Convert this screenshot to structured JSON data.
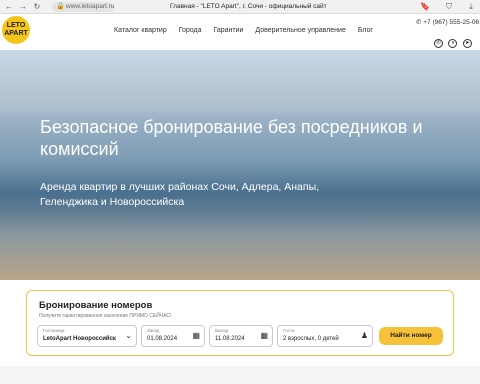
{
  "browser": {
    "url": "www.letoapart.ru",
    "tab_title": "Главная - \"LETO Apart\", г. Сочи - официальный сайт"
  },
  "header": {
    "logo_text": "LETO APART",
    "nav": [
      "Каталог квартир",
      "Города",
      "Гарантии",
      "Доверительное управление",
      "Блог"
    ],
    "phone": "+7 (967) 555-25-06"
  },
  "hero": {
    "title": "Безопасное бронирование без посредников и комиссий",
    "subtitle": "Аренда квартир в лучших районах Сочи, Адлера, Анапы, Геленджика и Новороссийска"
  },
  "booking": {
    "title": "Бронирование номеров",
    "note": "Получите гарантированное заселение ПРЯМО СЕЙЧАС!",
    "hotel_label": "Гостиница",
    "hotel_value": "LetoApart Новороссийск",
    "checkin_label": "Заезд",
    "checkin_value": "01.08.2024",
    "checkout_label": "Выезд",
    "checkout_value": "11.08.2024",
    "guests_label": "Гости",
    "guests_value": "2 взрослых, 0 детей",
    "button": "Найти номер"
  },
  "colors": {
    "accent": "#f6c23a",
    "border": "#f3c24b"
  }
}
